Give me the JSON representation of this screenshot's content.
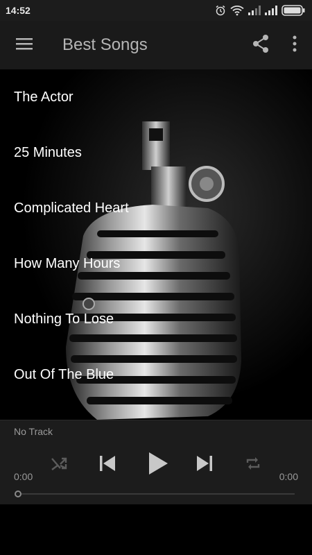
{
  "status_bar": {
    "time": "14:52",
    "icons": [
      "alarm-icon",
      "wifi-icon",
      "signal-icon",
      "signal-icon",
      "battery-icon"
    ]
  },
  "app_bar": {
    "title": "Best Songs",
    "icons": [
      "menu-icon",
      "share-icon",
      "more-vert-icon"
    ]
  },
  "songs": [
    "The Actor",
    "25 Minutes",
    "Complicated Heart",
    "How Many Hours",
    "Nothing To Lose",
    "Out Of The Blue"
  ],
  "player": {
    "track": "No Track",
    "current_time": "0:00",
    "total_time": "0:00",
    "progress": 0,
    "controls": [
      "shuffle-icon",
      "previous-icon",
      "play-icon",
      "next-icon",
      "repeat-icon"
    ]
  },
  "colors": {
    "app_bar_bg": "#1a1a1a",
    "player_bg": "#1c1c1c",
    "title_text": "#b5b5b5",
    "muted_text": "#9a9a9a"
  }
}
